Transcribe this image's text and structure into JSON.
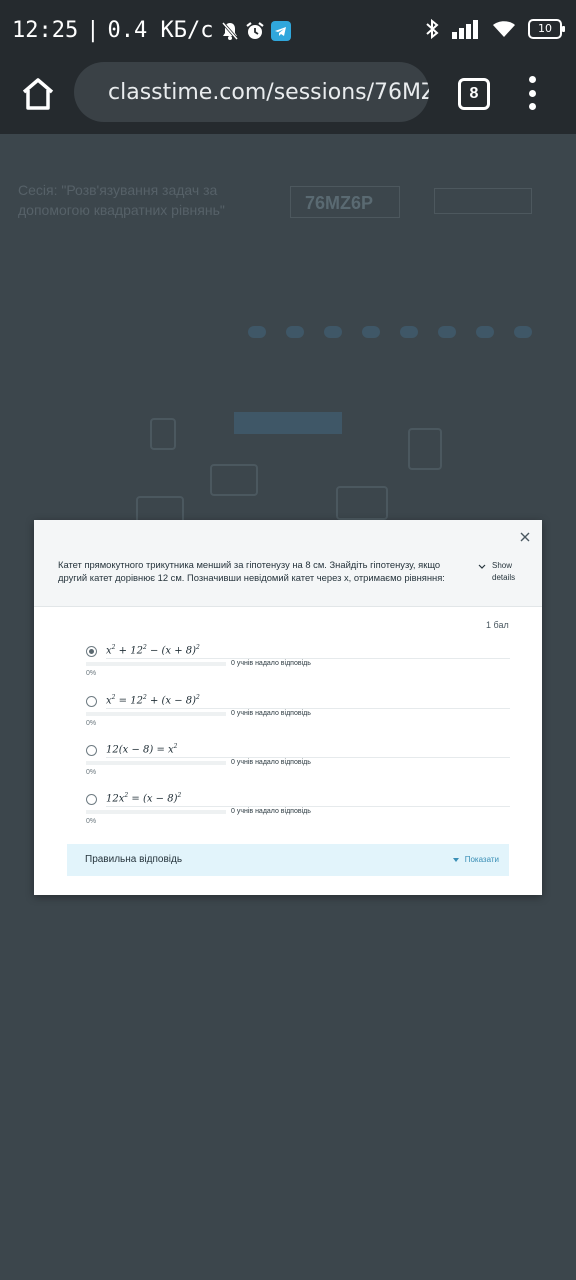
{
  "status_bar": {
    "time": "12:25",
    "speed": "0.4 КБ/с",
    "battery": "10"
  },
  "browser": {
    "url": "classtime.com/sessions/76MZ",
    "tab_count": "8"
  },
  "background": {
    "session_title": "Сесія: \"Розв'язування задач за допомогою квадратних рівнянь\"",
    "session_code": "76MZ6P"
  },
  "modal": {
    "question": "Катет прямокутного трикутника менший за гіпотенузу на 8 см. Знайдіть гіпотенузу, якщо другий катет дорівнює 12 см. Позначивши невідомий катет через x, отримаємо рівняння:",
    "show_details": "Show details",
    "points": "1 бал",
    "options": [
      {
        "checked": true,
        "count_text": "0 учнів надало відповідь",
        "percent": "0%",
        "progress": 0
      },
      {
        "checked": false,
        "count_text": "0 учнів надало відповідь",
        "percent": "0%",
        "progress": 0
      },
      {
        "checked": false,
        "count_text": "0 учнів надало відповідь",
        "percent": "0%",
        "progress": 0
      },
      {
        "checked": false,
        "count_text": "0 учнів надало відповідь",
        "percent": "0%",
        "progress": 0
      }
    ],
    "correct_answer_label": "Правильна відповідь",
    "show_label": "Показати"
  },
  "colors": {
    "overlay": "#3c464c",
    "system_bar": "#252a2e",
    "accent": "#3a8fb6",
    "correct_bg": "#e2f4fb"
  }
}
